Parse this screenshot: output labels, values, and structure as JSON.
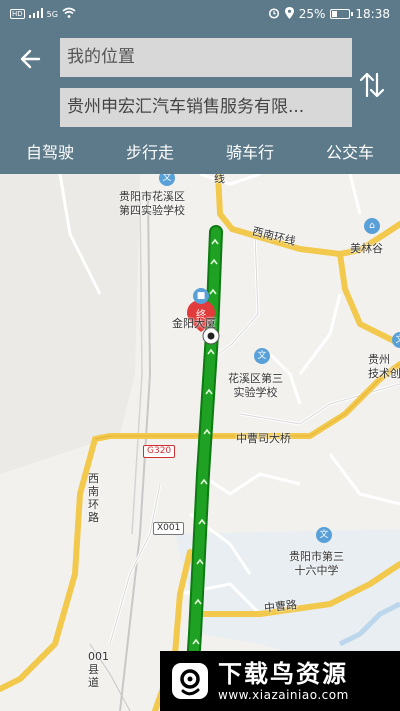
{
  "status_bar": {
    "signal_label": "HD",
    "network_label": "5G",
    "battery_percent": "25%",
    "battery_level": 0.25,
    "time": "18:38"
  },
  "header": {
    "origin_value": "我的位置",
    "destination_value": "贵州申宏汇汽车销售服务有限...",
    "modes": [
      "自驾驶",
      "步行走",
      "骑车行",
      "公交车"
    ]
  },
  "map": {
    "labels": {
      "school4_line1": "贵阳市花溪区",
      "school4_line2": "第四实验学校",
      "school3_line1": "花溪区第三",
      "school3_line2": "实验学校",
      "school16_line1": "贵阳市第三",
      "school16_line2": "十六中学",
      "tech_line1": "贵州",
      "tech_line2": "技术创",
      "jinyan": "金阳大厦",
      "meilingu": "美林谷"
    },
    "roads": {
      "xinan_ring": "西南环线",
      "xinan_ring_road": "西南环路",
      "zhongcaosi_bridge": "中曹司大桥",
      "zhongcao_road": "中曹路",
      "g320": "G320",
      "x001": "X001",
      "county_road": "001县道",
      "top_road": "线"
    },
    "end_marker": "终",
    "route_color": "#1fa224",
    "route_border": "#0d7a12"
  },
  "watermark": {
    "title": "下载鸟资源",
    "url": "www.xiazainiao.com"
  }
}
